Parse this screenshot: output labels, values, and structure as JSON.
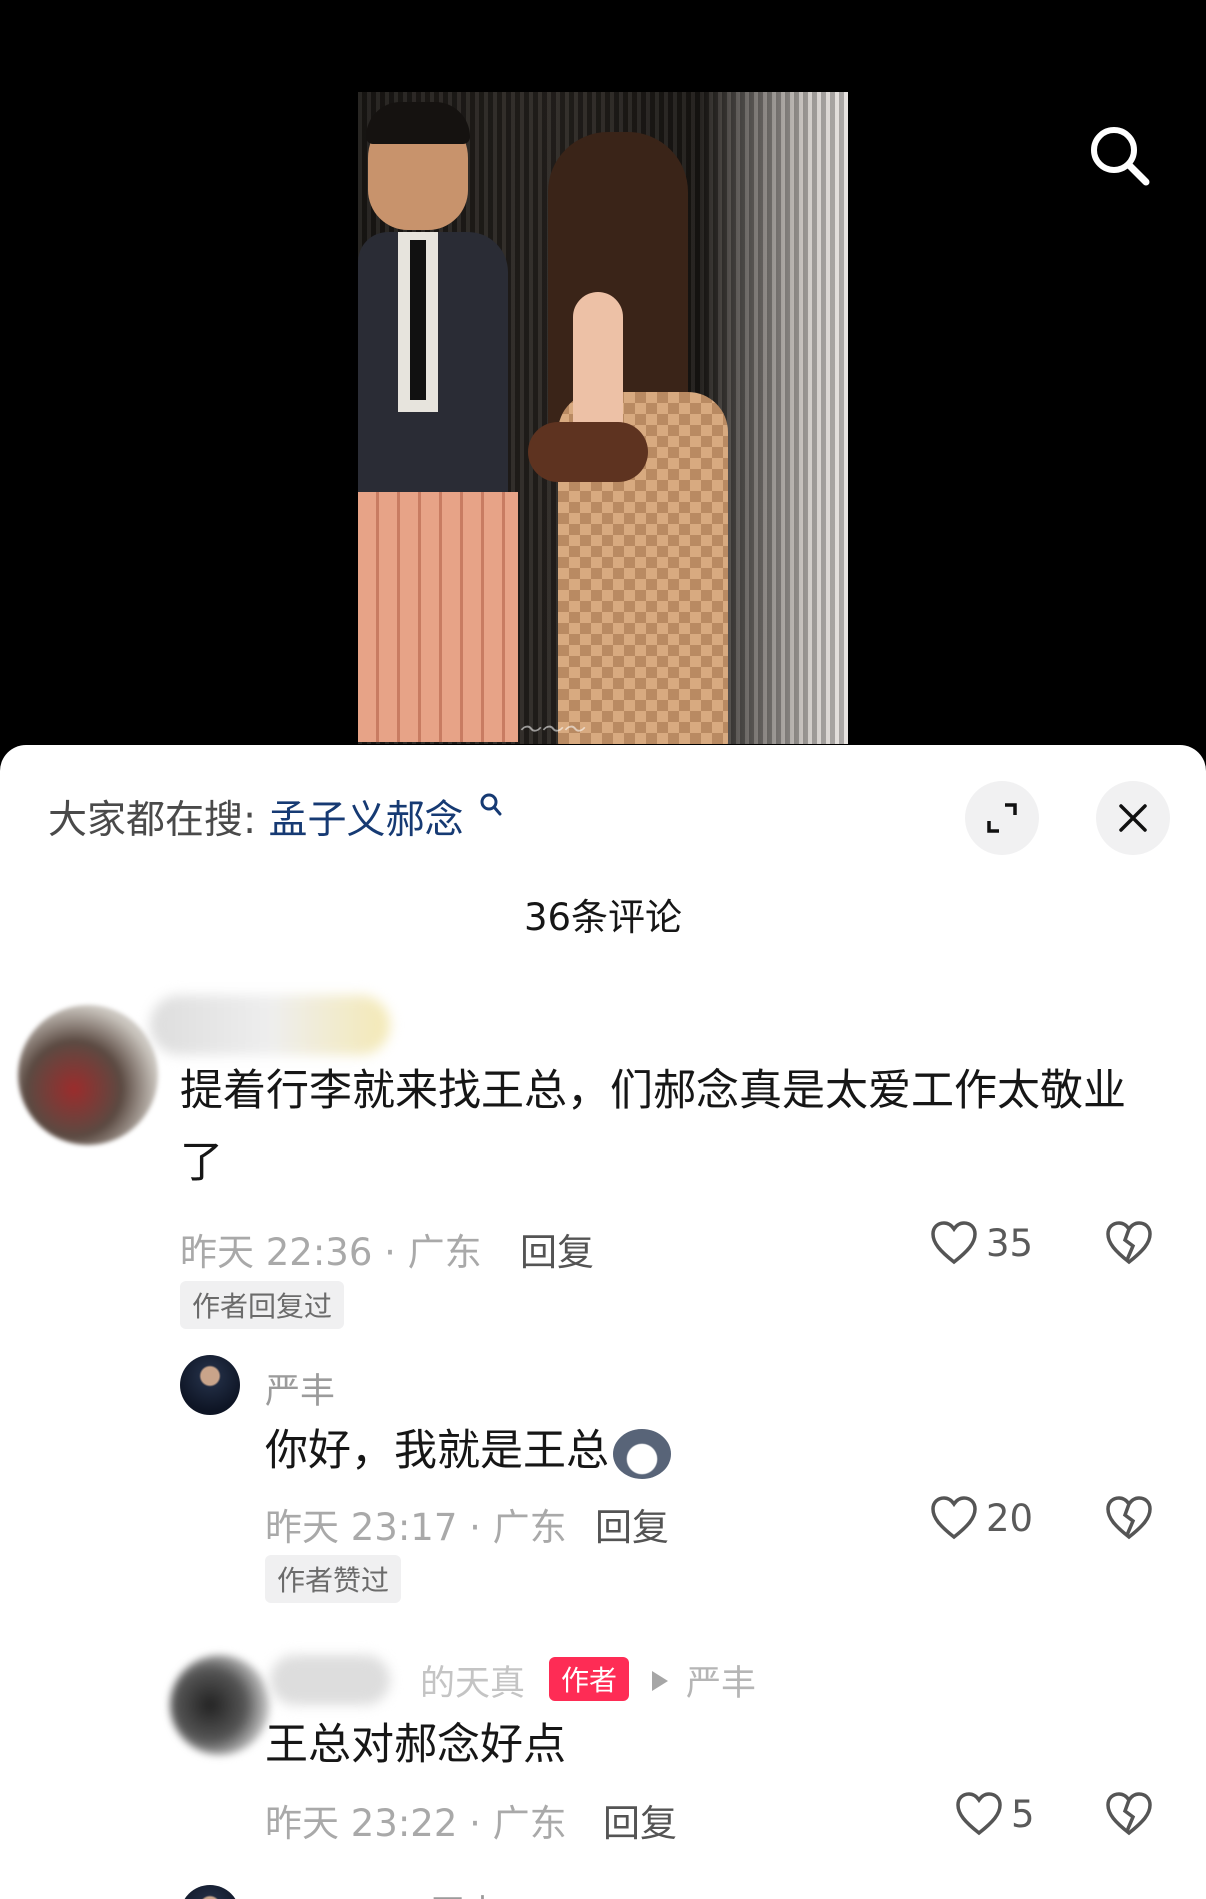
{
  "search": {
    "prefix": "大家都在搜:",
    "keyword": "孟子义郝念"
  },
  "comment_count": "36条评论",
  "comments": [
    {
      "username": "",
      "text_line1": "提着行李就来找王总，们郝念真是太爱工作太敬业",
      "text_line2": "了",
      "meta": "昨天 22:36 · 广东",
      "reply": "回复",
      "likes": "35",
      "tag": "作者回复过"
    },
    {
      "username": "严丰",
      "text": "你好，我就是王总",
      "meta": "昨天 23:17 · 广东",
      "reply": "回复",
      "likes": "20",
      "tag": "作者赞过"
    },
    {
      "username": "的天真",
      "author_badge": "作者",
      "reply_to": "严丰",
      "text": "王总对郝念好点",
      "meta": "昨天 23:22 · 广东",
      "reply": "回复",
      "likes": "5"
    },
    {
      "username": "严丰"
    }
  ],
  "icons": {
    "search": "search-icon",
    "expand": "expand-icon",
    "close": "close-icon",
    "like": "heart-icon",
    "dislike": "broken-heart-icon"
  }
}
